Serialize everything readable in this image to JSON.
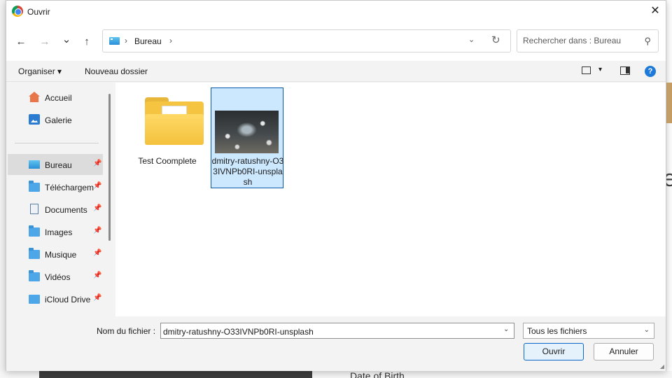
{
  "dialog": {
    "title": "Ouvrir",
    "close_glyph": "✕"
  },
  "nav": {
    "back_glyph": "←",
    "forward_glyph": "→",
    "recent_glyph": "⌄",
    "up_glyph": "↑",
    "breadcrumb": [
      "Bureau"
    ],
    "sep_glyph": "›",
    "dropdown_glyph": "⌄",
    "refresh_glyph": "↻"
  },
  "search": {
    "placeholder": "Rechercher dans : Bureau",
    "icon_glyph": "⚲"
  },
  "commandbar": {
    "organize": "Organiser ▾",
    "new_folder": "Nouveau dossier",
    "view_dd_glyph": "▾",
    "help_glyph": "?"
  },
  "sidebar": {
    "items": [
      {
        "label": "Accueil",
        "icon": "home-icon"
      },
      {
        "label": "Galerie",
        "icon": "gallery-icon"
      },
      {
        "label": "Bureau",
        "icon": "desktop-icon",
        "pinned": true,
        "active": true
      },
      {
        "label": "Téléchargements",
        "icon": "downloads-folder-icon",
        "pinned": true
      },
      {
        "label": "Documents",
        "icon": "documents-icon",
        "pinned": true
      },
      {
        "label": "Images",
        "icon": "pictures-folder-icon",
        "pinned": true
      },
      {
        "label": "Musique",
        "icon": "music-folder-icon",
        "pinned": true
      },
      {
        "label": "Vidéos",
        "icon": "videos-folder-icon",
        "pinned": true
      },
      {
        "label": "iCloud Drive",
        "icon": "icloud-folder-icon",
        "pinned": true
      }
    ],
    "pin_glyph": "📌"
  },
  "files": [
    {
      "name": "Test Coomplete",
      "type": "folder"
    },
    {
      "name": "dmitry-ratushny-O33IVNPb0RI-unsplash",
      "type": "image",
      "selected": true
    }
  ],
  "bottom": {
    "filename_label": "Nom du fichier :",
    "filename_value": "dmitry-ratushny-O33IVNPb0RI-unsplash",
    "filetype": "Tous les fichiers",
    "dd_glyph": "⌄",
    "open": "Ouvrir",
    "cancel": "Annuler"
  },
  "background": {
    "glyph": "e",
    "label": "Date of Birth"
  },
  "colors": {
    "selection": "#cce8ff",
    "accent": "#0b67c8",
    "folder": "#f5c542"
  }
}
